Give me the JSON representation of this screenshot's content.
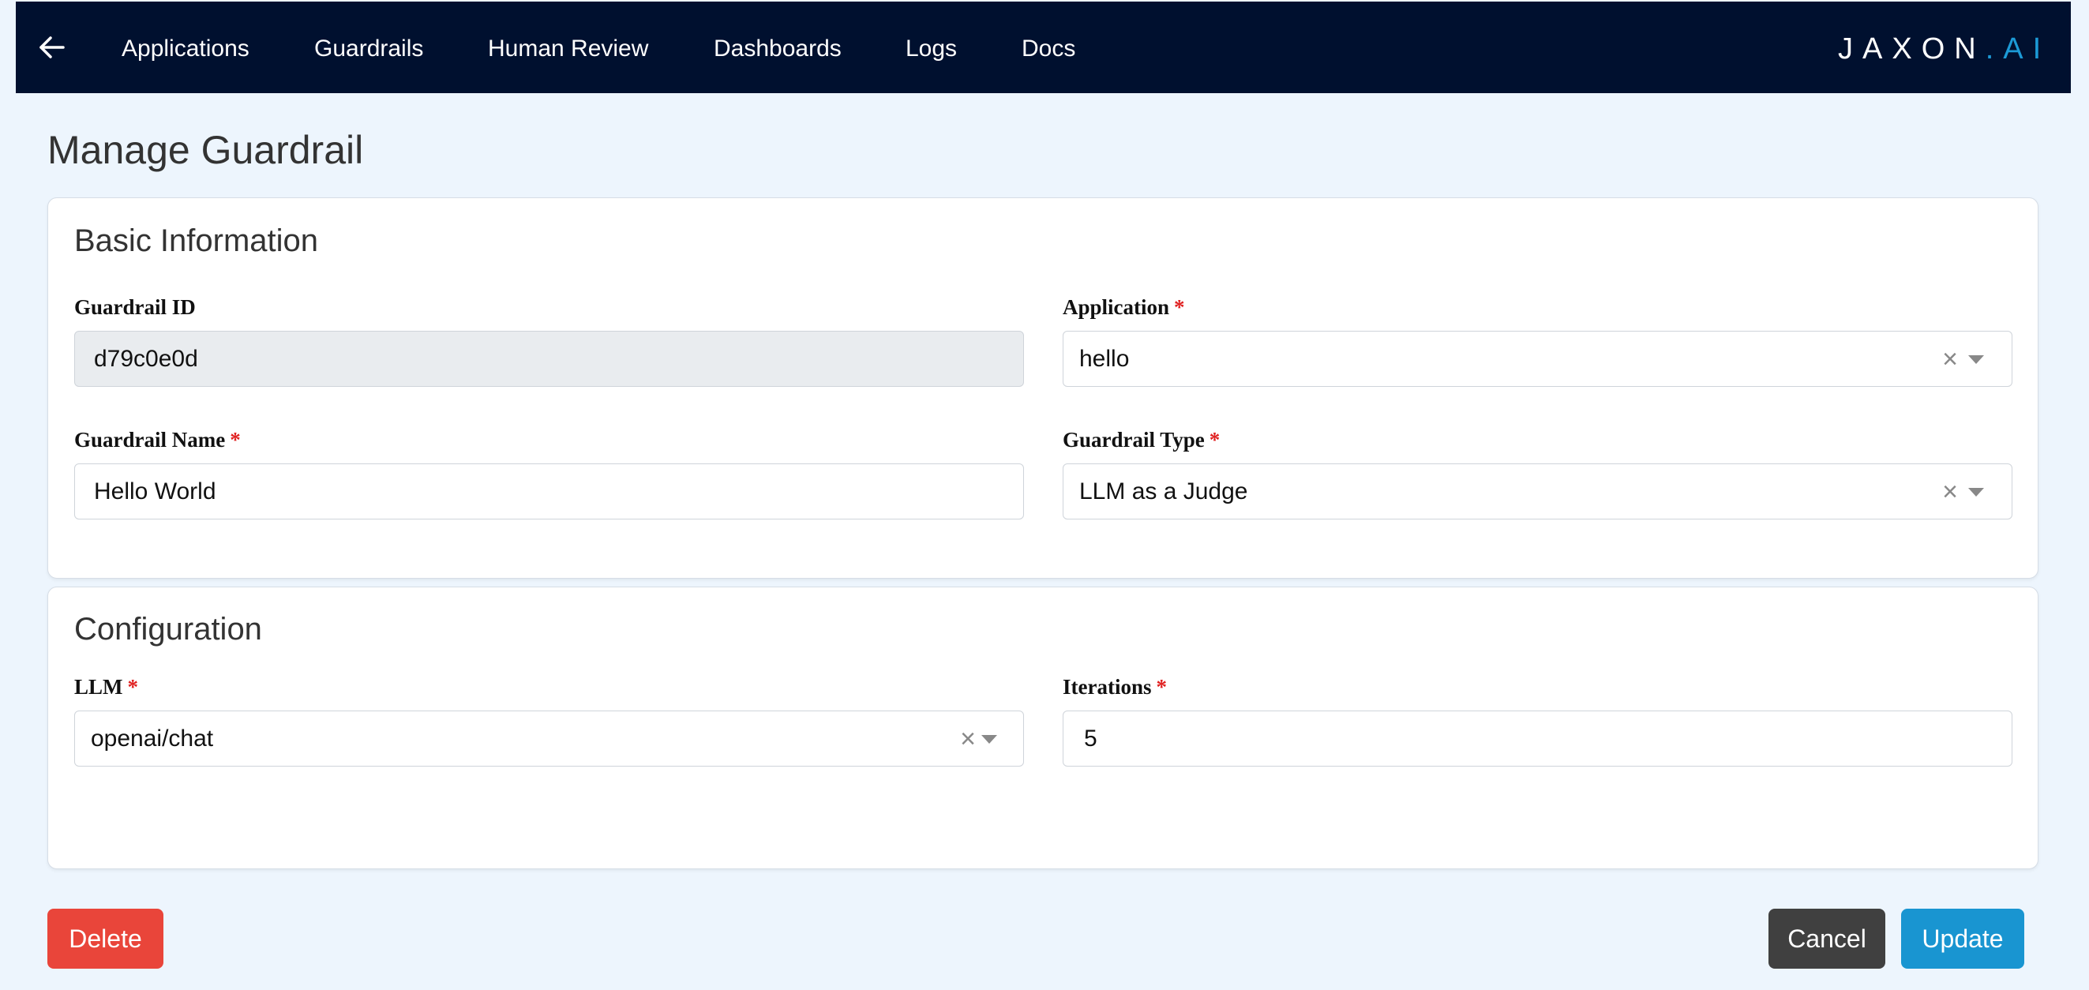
{
  "nav": {
    "items": [
      {
        "label": "Applications"
      },
      {
        "label": "Guardrails"
      },
      {
        "label": "Human Review"
      },
      {
        "label": "Dashboards"
      },
      {
        "label": "Logs"
      },
      {
        "label": "Docs"
      }
    ],
    "back_icon": "arrow-left-icon",
    "logo": {
      "text_main": "JAXON",
      "text_dot": ".",
      "text_ai": "AI",
      "accent_color": "#1c9ad6"
    }
  },
  "page": {
    "title": "Manage Guardrail"
  },
  "basic_info": {
    "title": "Basic Information",
    "guardrail_id": {
      "label": "Guardrail ID",
      "value": "d79c0e0d"
    },
    "application": {
      "label": "Application",
      "required_mark": "*",
      "value": "hello"
    },
    "guardrail_name": {
      "label": "Guardrail Name",
      "required_mark": "*",
      "value": "Hello World"
    },
    "guardrail_type": {
      "label": "Guardrail Type",
      "required_mark": "*",
      "value": "LLM as a Judge"
    }
  },
  "configuration": {
    "title": "Configuration",
    "llm": {
      "label": "LLM",
      "required_mark": "*",
      "value": "openai/chat"
    },
    "iterations": {
      "label": "Iterations",
      "required_mark": "*",
      "value": "5"
    }
  },
  "actions": {
    "delete_label": "Delete",
    "cancel_label": "Cancel",
    "update_label": "Update"
  },
  "icons": {
    "clear": "×"
  },
  "colors": {
    "navbar_bg": "#00102f",
    "delete": "#e9453a",
    "cancel": "#404040",
    "update": "#1995d1",
    "required": "#e02020"
  }
}
